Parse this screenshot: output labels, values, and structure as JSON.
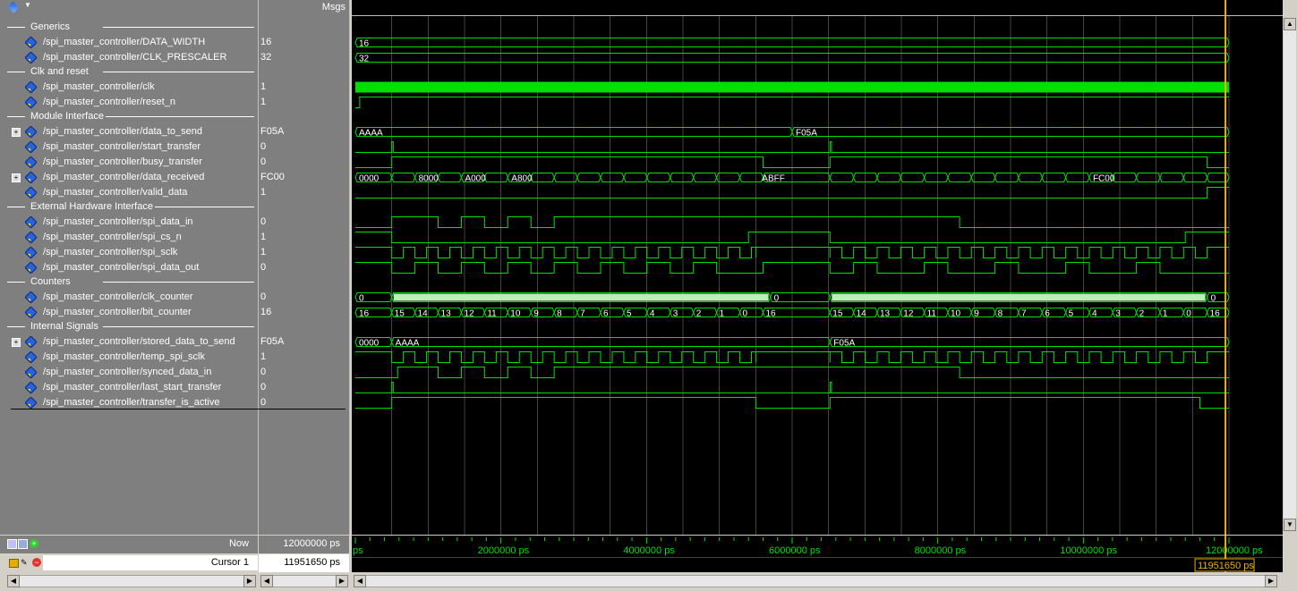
{
  "header": {
    "msgs_label": "Msgs"
  },
  "signals": [
    {
      "kind": "group",
      "label": "Generics"
    },
    {
      "kind": "signal",
      "name": "/spi_master_controller/DATA_WIDTH",
      "value": "16"
    },
    {
      "kind": "signal",
      "name": "/spi_master_controller/CLK_PRESCALER",
      "value": "32"
    },
    {
      "kind": "group",
      "label": "Clk and reset"
    },
    {
      "kind": "signal",
      "name": "/spi_master_controller/clk",
      "value": "1"
    },
    {
      "kind": "signal",
      "name": "/spi_master_controller/reset_n",
      "value": "1"
    },
    {
      "kind": "group",
      "label": "Module Interface"
    },
    {
      "kind": "signal",
      "name": "/spi_master_controller/data_to_send",
      "value": "F05A",
      "expandable": true
    },
    {
      "kind": "signal",
      "name": "/spi_master_controller/start_transfer",
      "value": "0"
    },
    {
      "kind": "signal",
      "name": "/spi_master_controller/busy_transfer",
      "value": "0"
    },
    {
      "kind": "signal",
      "name": "/spi_master_controller/data_received",
      "value": "FC00",
      "expandable": true
    },
    {
      "kind": "signal",
      "name": "/spi_master_controller/valid_data",
      "value": "1"
    },
    {
      "kind": "group",
      "label": "External Hardware Interface"
    },
    {
      "kind": "signal",
      "name": "/spi_master_controller/spi_data_in",
      "value": "0"
    },
    {
      "kind": "signal",
      "name": "/spi_master_controller/spi_cs_n",
      "value": "1"
    },
    {
      "kind": "signal",
      "name": "/spi_master_controller/spi_sclk",
      "value": "1"
    },
    {
      "kind": "signal",
      "name": "/spi_master_controller/spi_data_out",
      "value": "0"
    },
    {
      "kind": "group",
      "label": "Counters"
    },
    {
      "kind": "signal",
      "name": "/spi_master_controller/clk_counter",
      "value": "0"
    },
    {
      "kind": "signal",
      "name": "/spi_master_controller/bit_counter",
      "value": "16"
    },
    {
      "kind": "group",
      "label": "Internal Signals"
    },
    {
      "kind": "signal",
      "name": "/spi_master_controller/stored_data_to_send",
      "value": "F05A",
      "expandable": true
    },
    {
      "kind": "signal",
      "name": "/spi_master_controller/temp_spi_sclk",
      "value": "1"
    },
    {
      "kind": "signal",
      "name": "/spi_master_controller/synced_data_in",
      "value": "0"
    },
    {
      "kind": "signal",
      "name": "/spi_master_controller/last_start_transfer",
      "value": "0"
    },
    {
      "kind": "signal",
      "name": "/spi_master_controller/transfer_is_active",
      "value": "0"
    }
  ],
  "wave_labels": {
    "data_width": [
      "16"
    ],
    "clk_prescaler": [
      "32"
    ],
    "data_to_send": [
      "AAAA",
      "F05A"
    ],
    "data_received": [
      "0000",
      "8000",
      "A000",
      "A800",
      "ABFF",
      "FC00"
    ],
    "clk_counter": [
      "0",
      "0",
      "0"
    ],
    "bit_counter_1": [
      "16",
      "15",
      "14",
      "13",
      "12",
      "11",
      "10",
      "9",
      "8",
      "7",
      "6",
      "5",
      "4",
      "3",
      "2",
      "1",
      "0",
      "16"
    ],
    "bit_counter_2": [
      "15",
      "14",
      "13",
      "12",
      "11",
      "10",
      "9",
      "8",
      "7",
      "6",
      "5",
      "4",
      "3",
      "2",
      "1",
      "0",
      "16"
    ],
    "stored_data": [
      "0000",
      "AAAA",
      "F05A"
    ]
  },
  "status": {
    "now_label": "Now",
    "now_value": "12000000 ps",
    "cursor_label": "Cursor 1",
    "cursor_value": "11951650 ps",
    "cursor_flag": "11951650 ps"
  },
  "timeline": {
    "ticks": [
      "ps",
      "2000000 ps",
      "4000000 ps",
      "6000000 ps",
      "8000000 ps",
      "10000000 ps",
      "12000000 ps"
    ]
  },
  "colors": {
    "wave": "#00e000",
    "cursor": "#f0b000",
    "grid": "#707070",
    "background": "#000000",
    "panel": "#7f7f7f"
  },
  "icons": {
    "signal": "diamond-signal-icon",
    "expand": "plus-expander-icon",
    "toolbar": "wave-toolbar-icon"
  }
}
